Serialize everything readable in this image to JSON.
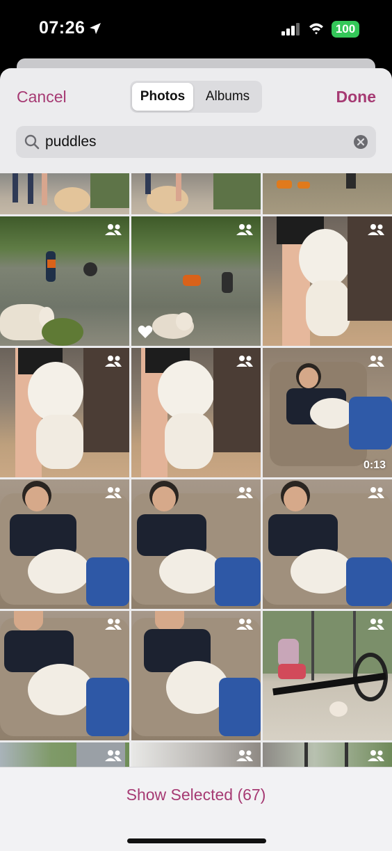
{
  "status_bar": {
    "time": "07:26",
    "battery": "100",
    "icons": [
      "location-arrow-icon",
      "cellular-signal-icon",
      "wifi-icon",
      "battery-icon"
    ]
  },
  "nav": {
    "cancel_label": "Cancel",
    "done_label": "Done",
    "segments": [
      "Photos",
      "Albums"
    ],
    "selected_segment": "Photos"
  },
  "search": {
    "value": "puddles"
  },
  "grid": {
    "overlay_icon": "shared-people-icon",
    "videos": [
      {
        "row": 2,
        "col": 2,
        "duration": "0:13"
      }
    ],
    "favorites": [
      {
        "row": 1,
        "col": 1
      }
    ]
  },
  "footer": {
    "show_selected_label": "Show Selected (67)"
  },
  "colors": {
    "accent": "#a63a73",
    "battery": "#34c759"
  }
}
